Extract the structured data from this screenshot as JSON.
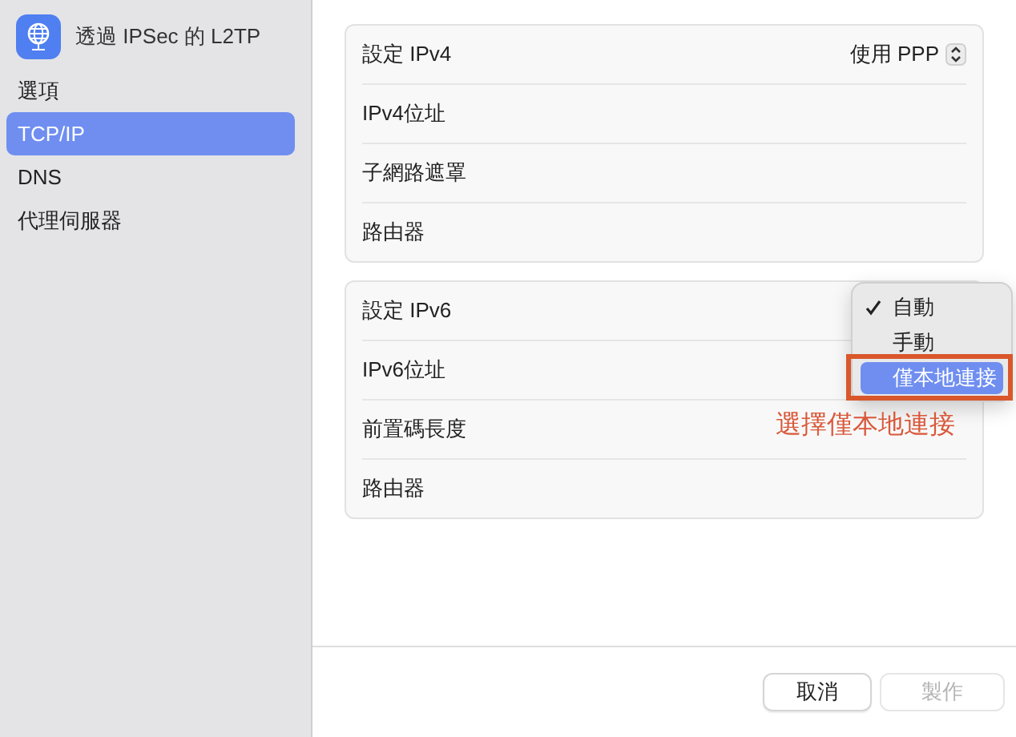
{
  "sidebar": {
    "title": "透過 IPSec 的 L2TP",
    "items": [
      {
        "label": "選項",
        "selected": false
      },
      {
        "label": "TCP/IP",
        "selected": true
      },
      {
        "label": "DNS",
        "selected": false
      },
      {
        "label": "代理伺服器",
        "selected": false
      }
    ]
  },
  "groups": [
    {
      "rows": [
        {
          "label": "設定 IPv4",
          "value": "使用 PPP"
        },
        {
          "label": "IPv4位址"
        },
        {
          "label": "子網路遮罩"
        },
        {
          "label": "路由器"
        }
      ]
    },
    {
      "rows": [
        {
          "label": "設定 IPv6"
        },
        {
          "label": "IPv6位址"
        },
        {
          "label": "前置碼長度"
        },
        {
          "label": "路由器"
        }
      ]
    }
  ],
  "menu": {
    "items": [
      {
        "label": "自動",
        "checked": true,
        "selected": false
      },
      {
        "label": "手動",
        "checked": false,
        "selected": false
      },
      {
        "label": "僅本地連接",
        "checked": false,
        "selected": true
      }
    ]
  },
  "annotation": {
    "text": "選擇僅本地連接"
  },
  "buttons": [
    {
      "label": "取消",
      "disabled": false
    },
    {
      "label": "製作",
      "disabled": true
    }
  ]
}
